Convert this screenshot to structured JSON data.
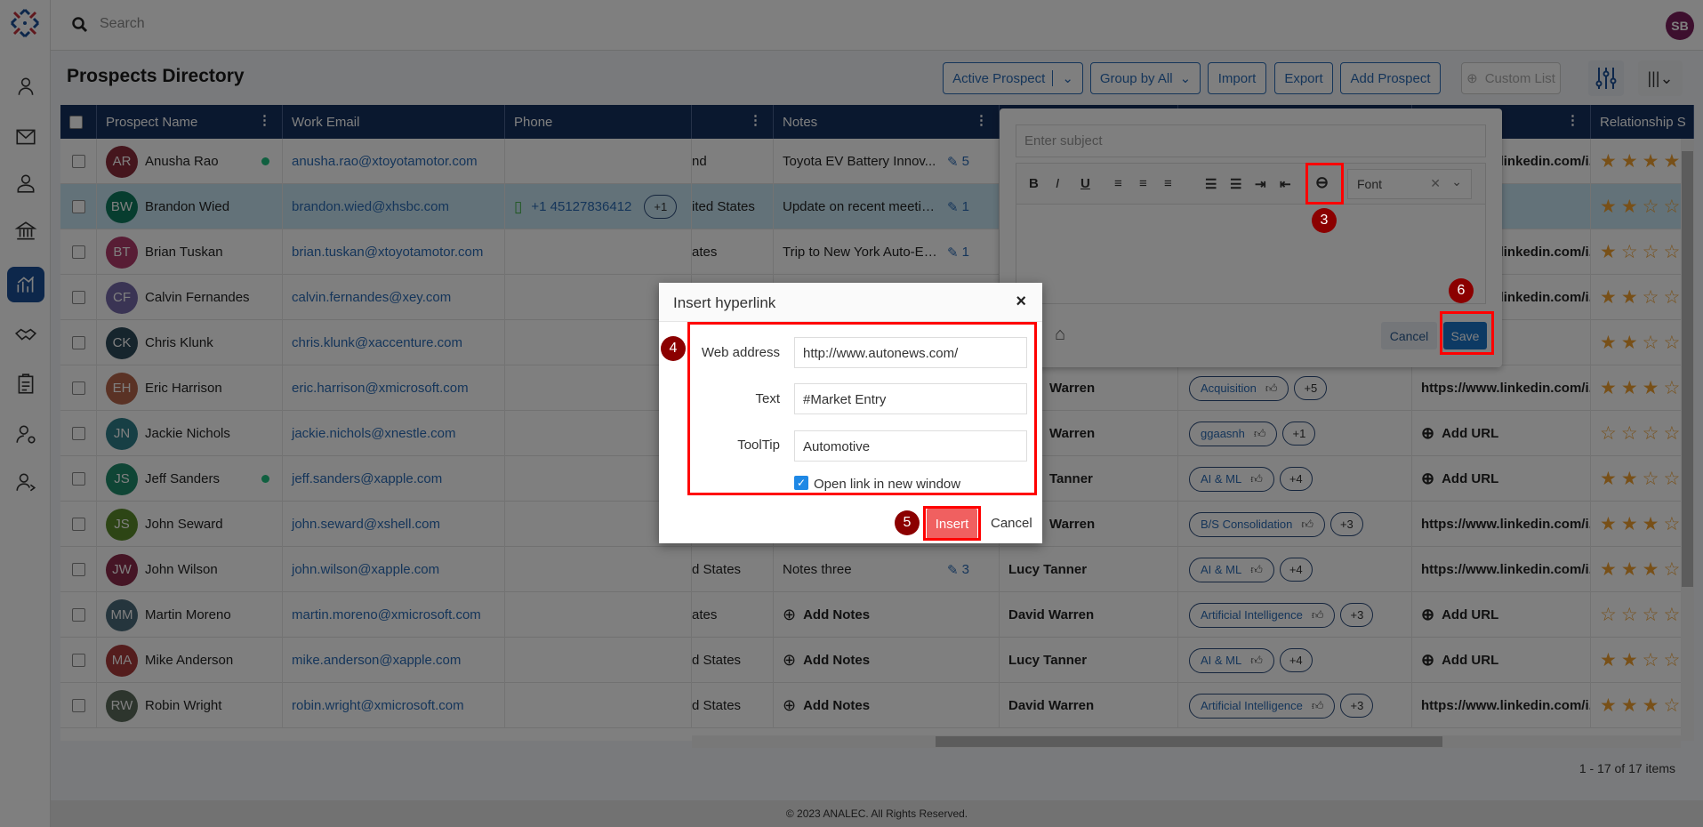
{
  "app": {
    "search_placeholder": "Search",
    "user_initials": "SB",
    "page_title": "Prospects Directory",
    "footer": "© 2023 ANALEC. All Rights Reserved.",
    "pager": "1 - 17 of 17 items"
  },
  "toolbar": {
    "active_prospect": "Active Prospect",
    "group_by": "Group by All",
    "import": "Import",
    "export": "Export",
    "add_prospect": "Add Prospect",
    "custom_list": "Custom List"
  },
  "sidebar": {
    "items": [
      "user-check-icon",
      "mail-icon",
      "user-icon",
      "bank-icon",
      "analytics-icon",
      "handshake-icon",
      "clipboard-icon",
      "user-gear-icon",
      "user-share-icon"
    ],
    "active": "analytics-icon"
  },
  "columns": [
    "Prospect Name",
    "Work Email",
    "Phone",
    "",
    "Notes",
    "",
    "",
    "",
    "Relationship S"
  ],
  "rows": [
    {
      "initials": "AR",
      "name": "Anusha Rao",
      "online": true,
      "email": "anusha.rao@xtoyotamotor.com",
      "phone": "",
      "phone_more": "",
      "country": "nd",
      "notes": "Toyota EV Battery Innov...",
      "notes_count": "5",
      "owner": "",
      "tag": "",
      "tag_more": "",
      "linkedin": "https://www.linkedin.com/i...",
      "rating": 4,
      "color": "#8b2c3a"
    },
    {
      "initials": "BW",
      "name": "Brandon Wied",
      "online": false,
      "selected": true,
      "email": "brandon.wied@xhsbc.com",
      "phone": "+1 45127836412",
      "phone_more": "+1",
      "country": "ited States",
      "notes": "Update on recent meetin...",
      "notes_count": "1",
      "owner": "",
      "tag": "",
      "tag_more": "",
      "linkedin": "",
      "rating": 2,
      "color": "#0f7a5e"
    },
    {
      "initials": "BT",
      "name": "Brian Tuskan",
      "online": false,
      "email": "brian.tuskan@xtoyotamotor.com",
      "phone": "",
      "phone_more": "",
      "country": "ates",
      "notes": "Trip to New York Auto-Ex...",
      "notes_count": "1",
      "owner": "",
      "tag": "",
      "tag_more": "",
      "linkedin": "https://www.linkedin.com/i...",
      "rating": 1,
      "color": "#b03a6a"
    },
    {
      "initials": "CF",
      "name": "Calvin Fernandes",
      "online": false,
      "email": "calvin.fernandes@xey.com",
      "phone": "",
      "phone_more": "",
      "country": "",
      "notes": "",
      "notes_count": "",
      "owner": "",
      "tag": "",
      "tag_more": "",
      "linkedin": "https://www.linkedin.com/i...",
      "rating": 2,
      "color": "#7469a8"
    },
    {
      "initials": "CK",
      "name": "Chris Klunk",
      "online": false,
      "email": "chris.klunk@xaccenture.com",
      "phone": "",
      "phone_more": "",
      "country": "",
      "notes": "",
      "notes_count": "",
      "owner": "",
      "tag": "",
      "tag_more": "",
      "linkedin": "",
      "rating": 2,
      "color": "#2d4a5a"
    },
    {
      "initials": "EH",
      "name": "Eric Harrison",
      "online": false,
      "email": "eric.harrison@xmicrosoft.com",
      "phone": "",
      "phone_more": "",
      "country": "",
      "notes": "",
      "notes_count": "",
      "owner": "Warren",
      "tag": "Acquisition",
      "tag_more": "+5",
      "linkedin": "https://www.linkedin.com/i...",
      "rating": 3,
      "color": "#b5644a"
    },
    {
      "initials": "JN",
      "name": "Jackie Nichols",
      "online": false,
      "email": "jackie.nichols@xnestle.com",
      "phone": "",
      "phone_more": "",
      "country": "",
      "notes": "",
      "notes_count": "",
      "owner": "Warren",
      "tag": "ggaasnh",
      "tag_more": "+1",
      "linkedin": "Add URL",
      "rating": 0,
      "color": "#2f7f8a"
    },
    {
      "initials": "JS",
      "name": "Jeff Sanders",
      "online": true,
      "email": "jeff.sanders@xapple.com",
      "phone": "",
      "phone_more": "",
      "country": "",
      "notes": "",
      "notes_count": "",
      "owner": "Tanner",
      "tag": "AI & ML",
      "tag_more": "+4",
      "linkedin": "Add URL",
      "rating": 2,
      "color": "#1f8a6a"
    },
    {
      "initials": "JS",
      "name": "John Seward",
      "online": false,
      "email": "john.seward@xshell.com",
      "phone": "",
      "phone_more": "",
      "country": "",
      "notes": "",
      "notes_count": "",
      "owner": "Warren",
      "tag": "B/S Consolidation",
      "tag_more": "+3",
      "linkedin": "https://www.linkedin.com/i...",
      "rating": 3,
      "color": "#5a8a2a"
    },
    {
      "initials": "JW",
      "name": "John Wilson",
      "online": false,
      "email": "john.wilson@xapple.com",
      "phone": "",
      "phone_more": "",
      "country": "d States",
      "notes": "Notes three",
      "notes_count": "3",
      "owner": "Lucy Tanner",
      "tag": "AI & ML",
      "tag_more": "+4",
      "linkedin": "https://www.linkedin.com/i...",
      "rating": 3,
      "color": "#8a2a4a"
    },
    {
      "initials": "MM",
      "name": "Martin Moreno",
      "online": false,
      "email": "martin.moreno@xmicrosoft.com",
      "phone": "",
      "phone_more": "",
      "country": "ates",
      "notes": "Add Notes",
      "notes_count": "",
      "owner": "David Warren",
      "tag": "Artificial Intelligence",
      "tag_more": "+3",
      "linkedin": "Add URL",
      "rating": 0,
      "color": "#4a6a7a"
    },
    {
      "initials": "MA",
      "name": "Mike Anderson",
      "online": false,
      "email": "mike.anderson@xapple.com",
      "phone": "",
      "phone_more": "",
      "country": "d States",
      "notes": "Add Notes",
      "notes_count": "",
      "owner": "Lucy Tanner",
      "tag": "AI & ML",
      "tag_more": "+4",
      "linkedin": "Add URL",
      "rating": 2,
      "color": "#a83a3a"
    },
    {
      "initials": "RW",
      "name": "Robin Wright",
      "online": false,
      "email": "robin.wright@xmicrosoft.com",
      "phone": "",
      "phone_more": "",
      "country": "d States",
      "notes": "Add Notes",
      "notes_count": "",
      "owner": "David Warren",
      "tag": "Artificial Intelligence",
      "tag_more": "+3",
      "linkedin": "https://www.linkedin.com/i...",
      "rating": 3,
      "color": "#5a6a5a"
    }
  ],
  "compose": {
    "subject_placeholder": "Enter subject",
    "font_select": "Font",
    "cancel": "Cancel",
    "save": "Save",
    "toolbar": [
      "B",
      "I",
      "U"
    ]
  },
  "dialog": {
    "title": "Insert hyperlink",
    "web_address_label": "Web address",
    "web_address": "http://www.autonews.com/",
    "text_label": "Text",
    "text": "#Market Entry",
    "tooltip_label": "ToolTip",
    "tooltip": "Automotive",
    "new_window_label": "Open link in new window",
    "new_window_checked": true,
    "insert": "Insert",
    "cancel": "Cancel"
  },
  "annotations": [
    "3",
    "4",
    "5",
    "6"
  ],
  "colors": {
    "accent": "#2a6bb5",
    "header": "#15305e",
    "annotation": "#ff0000",
    "badge": "#8b0000",
    "insert": "#f06060"
  }
}
